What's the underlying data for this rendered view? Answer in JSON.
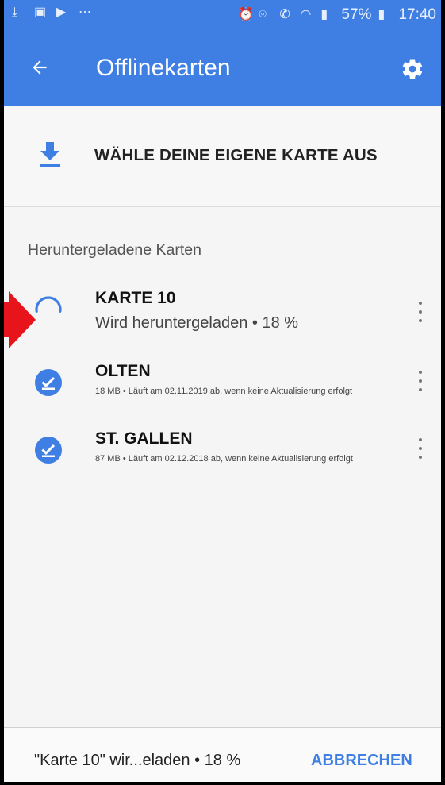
{
  "status_bar": {
    "left_icons": [
      "download-icon",
      "image-icon",
      "video-icon",
      "more-notifications-icon"
    ],
    "right_icons": [
      "alarm-icon",
      "location-icon",
      "wifi-calling-icon",
      "wifi-icon",
      "signal-icon"
    ],
    "battery": "57%",
    "time": "17:40"
  },
  "app_bar": {
    "title": "Offlinekarten",
    "back_icon": "arrow-back-icon",
    "settings_icon": "gear-icon",
    "color": "#3f7fe3"
  },
  "pick_own_map": {
    "label": "WÄHLE DEINE EIGENE KARTE AUS",
    "icon": "download-icon"
  },
  "downloaded": {
    "section_title": "Heruntergeladene Karten",
    "items": [
      {
        "title": "KARTE 10",
        "subtitle": "Wird heruntergeladen • 18 %",
        "progress": 0.18,
        "status": "downloading"
      },
      {
        "title": "OLTEN",
        "subtitle": "18 MB • Läuft am 02.11.2019 ab, wenn keine Aktualisierung erfolgt",
        "status": "downloaded"
      },
      {
        "title": "ST. GALLEN",
        "subtitle": "87 MB • Läuft am 02.12.2018 ab, wenn keine Aktualisierung erfolgt",
        "status": "downloaded"
      }
    ]
  },
  "snackbar": {
    "text": "\"Karte 10\" wir...eladen • 18 %",
    "action": "ABBRECHEN"
  },
  "colors": {
    "accent": "#3f7fe3",
    "annotation_arrow": "#e8141b"
  }
}
